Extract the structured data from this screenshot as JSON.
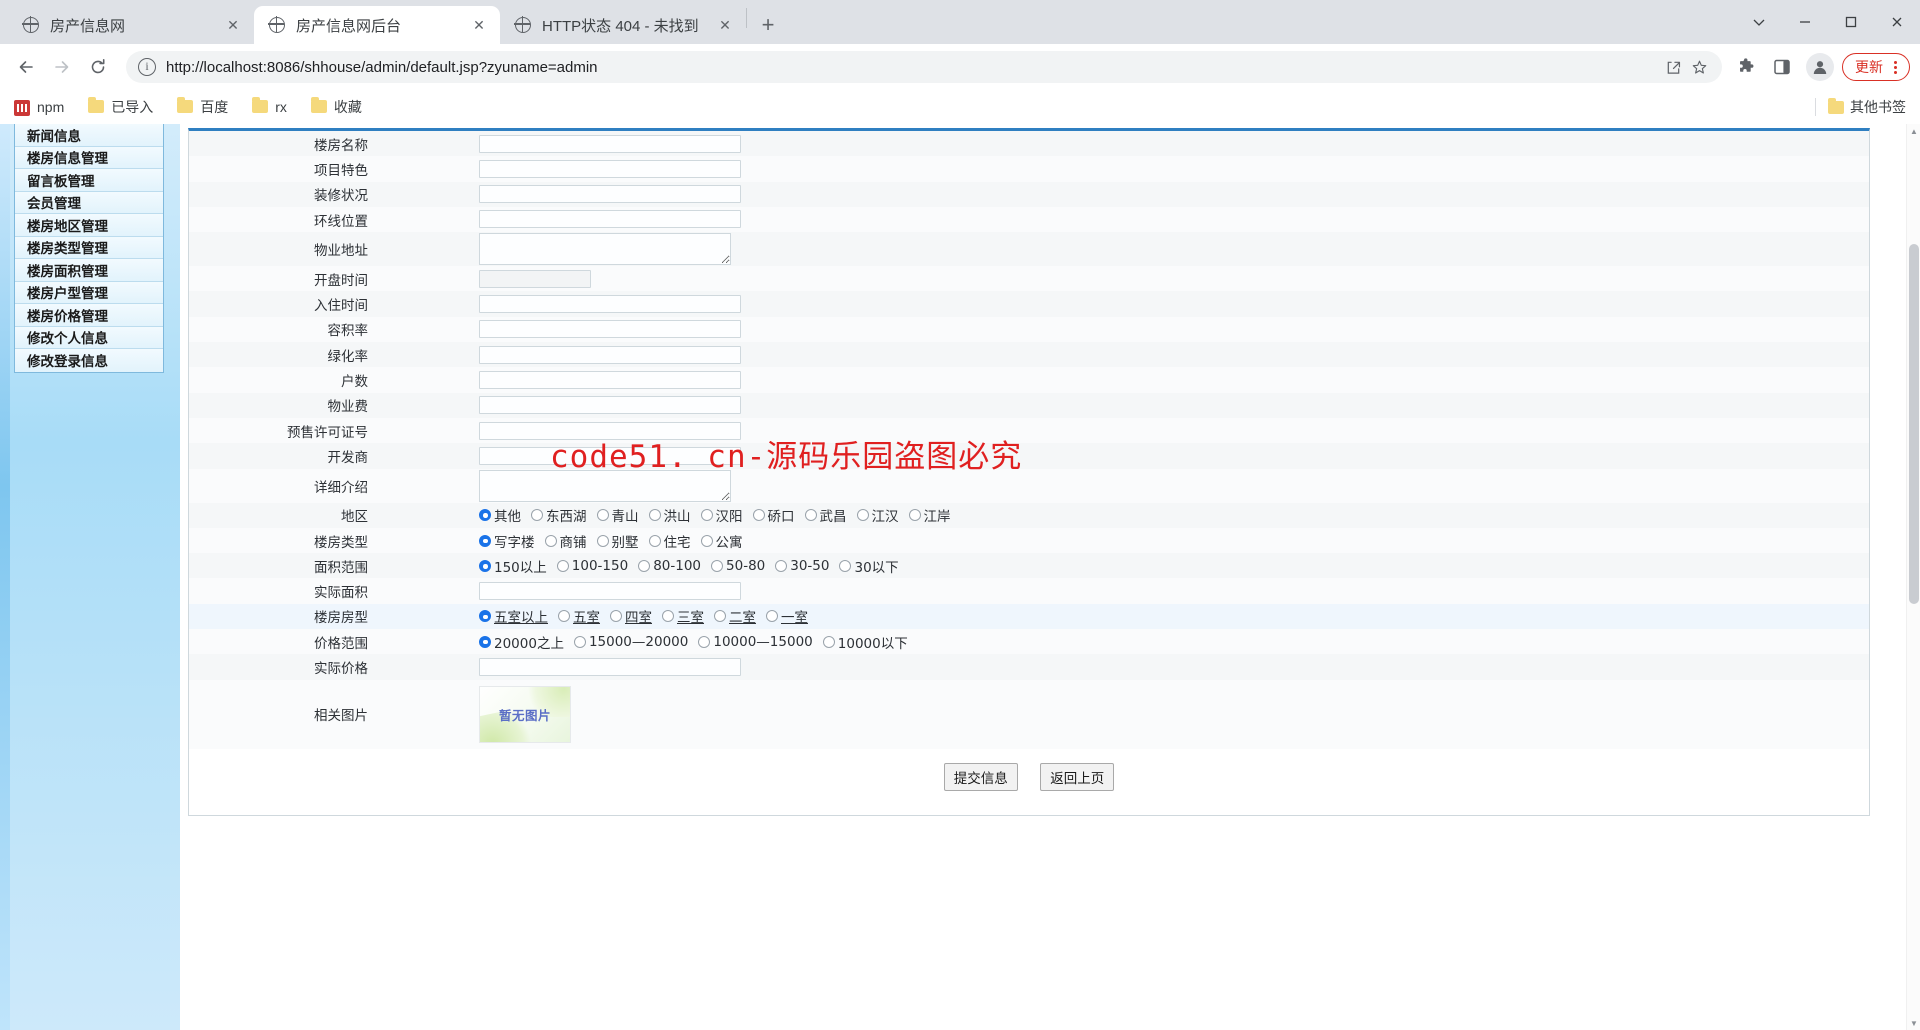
{
  "browser": {
    "tabs": [
      {
        "title": "房产信息网",
        "active": false,
        "close": "✕"
      },
      {
        "title": "房产信息网后台",
        "active": true,
        "close": "✕"
      },
      {
        "title": "HTTP状态 404 - 未找到",
        "active": false,
        "close": "✕"
      }
    ],
    "new_tab_label": "+",
    "window_controls": {
      "minimize": "—",
      "maximize": "▢",
      "close": "✕",
      "chevron": "⌄"
    },
    "url": "http://localhost:8086/shhouse/admin/default.jsp?zyuname=admin",
    "update_button": "更新",
    "bookmarks": [
      {
        "label": "npm",
        "icon": "npm-icon"
      },
      {
        "label": "已导入",
        "icon": "folder-icon"
      },
      {
        "label": "百度",
        "icon": "folder-icon"
      },
      {
        "label": "rx",
        "icon": "folder-icon"
      },
      {
        "label": "收藏",
        "icon": "folder-icon"
      }
    ],
    "other_bookmarks": "其他书签"
  },
  "sidebar": {
    "items": [
      {
        "label": "新闻信息"
      },
      {
        "label": "楼房信息管理"
      },
      {
        "label": "留言板管理"
      },
      {
        "label": "会员管理"
      },
      {
        "label": "楼房地区管理"
      },
      {
        "label": "楼房类型管理"
      },
      {
        "label": "楼房面积管理"
      },
      {
        "label": "楼房户型管理"
      },
      {
        "label": "楼房价格管理"
      },
      {
        "label": "修改个人信息"
      },
      {
        "label": "修改登录信息"
      }
    ]
  },
  "watermark": "code51. cn-源码乐园盗图必究",
  "form": {
    "rows": [
      {
        "label": "楼房名称",
        "type": "text",
        "value": ""
      },
      {
        "label": "项目特色",
        "type": "text",
        "value": ""
      },
      {
        "label": "装修状况",
        "type": "text",
        "value": ""
      },
      {
        "label": "环线位置",
        "type": "text",
        "value": ""
      },
      {
        "label": "物业地址",
        "type": "textarea",
        "value": ""
      },
      {
        "label": "开盘时间",
        "type": "text-short",
        "value": ""
      },
      {
        "label": "入住时间",
        "type": "text",
        "value": ""
      },
      {
        "label": "容积率",
        "type": "text",
        "value": ""
      },
      {
        "label": "绿化率",
        "type": "text",
        "value": ""
      },
      {
        "label": "户数",
        "type": "text",
        "value": ""
      },
      {
        "label": "物业费",
        "type": "text",
        "value": ""
      },
      {
        "label": "预售许可证号",
        "type": "text",
        "value": ""
      },
      {
        "label": "开发商",
        "type": "text",
        "value": ""
      },
      {
        "label": "详细介绍",
        "type": "textarea",
        "value": ""
      },
      {
        "label": "地区",
        "type": "radio",
        "selected": 0,
        "options": [
          "其他",
          "东西湖",
          "青山",
          "洪山",
          "汉阳",
          "硚口",
          "武昌",
          "江汉",
          "江岸"
        ]
      },
      {
        "label": "楼房类型",
        "type": "radio",
        "selected": 0,
        "options": [
          "写字楼",
          "商铺",
          "别墅",
          "住宅",
          "公寓"
        ]
      },
      {
        "label": "面积范围",
        "type": "radio",
        "selected": 0,
        "options": [
          "150以上",
          "100-150",
          "80-100",
          "50-80",
          "30-50",
          "30以下"
        ]
      },
      {
        "label": "实际面积",
        "type": "text",
        "value": ""
      },
      {
        "label": "楼房房型",
        "type": "radio",
        "selected": 0,
        "highlight": true,
        "options": [
          "五室以上",
          "五室",
          "四室",
          "三室",
          "二室",
          "一室"
        ]
      },
      {
        "label": "价格范围",
        "type": "radio",
        "selected": 0,
        "options": [
          "20000之上",
          "15000—20000",
          "10000—15000",
          "10000以下"
        ]
      },
      {
        "label": "实际价格",
        "type": "text",
        "value": ""
      },
      {
        "label": "相关图片",
        "type": "image",
        "placeholder_text": "暂无图片"
      }
    ],
    "submit_label": "提交信息",
    "back_label": "返回上页"
  },
  "colors": {
    "accent": "#2f7fc1",
    "radio_checked": "#1a73e8",
    "watermark": "#e02020",
    "sidebar_gradient_top": "#d3ecfb",
    "update_red": "#d93025"
  }
}
